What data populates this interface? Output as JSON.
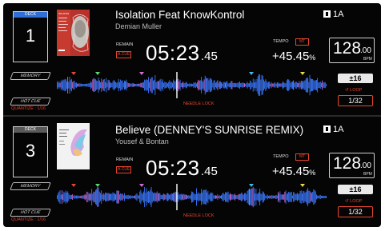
{
  "decks": [
    {
      "deck_label": "DECK",
      "deck_number": "1",
      "memory_label": "MEMORY",
      "hot_cue_label": "HOT CUE",
      "quantize_label": "QUANTIZE : 1/16",
      "artwork_text": "ISOLATION",
      "track_title": "Isolation Feat KnowKontrol",
      "artist": "Demian Muller",
      "remain_label": "REMAIN",
      "a_cue_label": "A.CUE",
      "time_main": "05:23",
      "time_frac": ".45",
      "key_value": "1A",
      "tempo_label": "TEMPO",
      "mt_label": "MT",
      "tempo_value": "+45.45",
      "tempo_unit": "%",
      "bpm_int": "128",
      "bpm_frac": ".00",
      "bpm_unit": "BPM",
      "needle_lock_label": "NEEDLE LOCK",
      "tempo_range": "±16",
      "loop_label": "LOOP",
      "loop_value": "1/32"
    },
    {
      "deck_label": "DECK",
      "deck_number": "3",
      "memory_label": "MEMORY",
      "hot_cue_label": "HOT CUE",
      "quantize_label": "QUANTIZE : 1/16",
      "artwork_text": "",
      "track_title": "Believe (DENNEY'S SUNRISE REMIX)",
      "artist": "Yousef & Bontan",
      "remain_label": "REMAIN",
      "a_cue_label": "A.CUE",
      "time_main": "05:23",
      "time_frac": ".45",
      "key_value": "1A",
      "tempo_label": "TEMPO",
      "mt_label": "MT",
      "tempo_value": "+45.45",
      "tempo_unit": "%",
      "bpm_int": "128",
      "bpm_frac": ".00",
      "bpm_unit": "BPM",
      "needle_lock_label": "NEEDLE LOCK",
      "tempo_range": "±16",
      "loop_label": "LOOP",
      "loop_value": "1/32"
    }
  ],
  "colors": {
    "accent_red": "#e8452f",
    "deck1_tag": "#2f6fd6",
    "deck3_tag": "#5a5a5a",
    "waveform_blue": "#3a78ff",
    "waveform_pink": "#d46bd8",
    "playhead": "#ffffff"
  }
}
